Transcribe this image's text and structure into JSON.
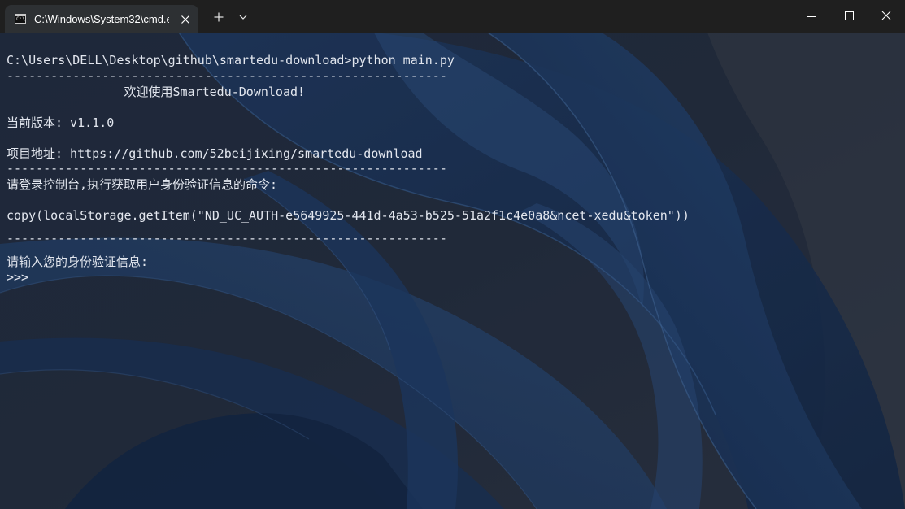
{
  "tab": {
    "icon_text": "C:\\.",
    "title": "C:\\Windows\\System32\\cmd.e"
  },
  "toolbar": {
    "new_tab": "+",
    "dropdown": "v"
  },
  "window_controls": {
    "minimize": "minimize",
    "maximize": "maximize",
    "close": "close"
  },
  "terminal": {
    "prompt_command": "C:\\Users\\DELL\\Desktop\\github\\smartedu-download>python main.py",
    "separator_1": "------------------------------------------------------------",
    "welcome": "                欢迎使用Smartedu-Download!",
    "version": "当前版本: v1.1.0",
    "project": "项目地址: https://github.com/52beijixing/smartedu-download",
    "separator_2": "------------------------------------------------------------",
    "login_hint": "请登录控制台,执行获取用户身份验证信息的命令:",
    "command": "copy(localStorage.getItem(\"ND_UC_AUTH-e5649925-441d-4a53-b525-51a2f1c4e0a8&ncet-xedu&token\"))",
    "separator_3": "------------------------------------------------------------",
    "input_prompt": "请输入您的身份验证信息:",
    "repl_prompt": ">>>"
  },
  "colors": {
    "titlebar": "#1f1f1f",
    "tab": "#2d3033",
    "terminal_text": "#e2e6ee",
    "terminal_bg": "#1e2738"
  }
}
